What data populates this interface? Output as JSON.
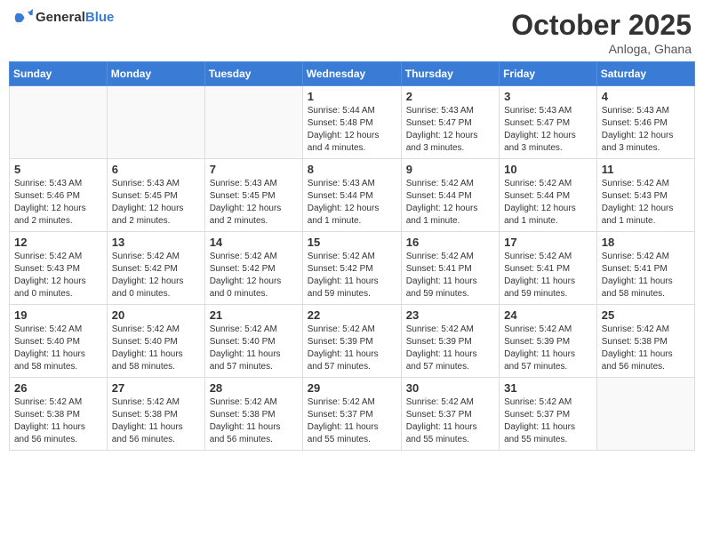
{
  "header": {
    "logo_general": "General",
    "logo_blue": "Blue",
    "month": "October 2025",
    "location": "Anloga, Ghana"
  },
  "weekdays": [
    "Sunday",
    "Monday",
    "Tuesday",
    "Wednesday",
    "Thursday",
    "Friday",
    "Saturday"
  ],
  "weeks": [
    [
      {
        "day": "",
        "info": ""
      },
      {
        "day": "",
        "info": ""
      },
      {
        "day": "",
        "info": ""
      },
      {
        "day": "1",
        "info": "Sunrise: 5:44 AM\nSunset: 5:48 PM\nDaylight: 12 hours\nand 4 minutes."
      },
      {
        "day": "2",
        "info": "Sunrise: 5:43 AM\nSunset: 5:47 PM\nDaylight: 12 hours\nand 3 minutes."
      },
      {
        "day": "3",
        "info": "Sunrise: 5:43 AM\nSunset: 5:47 PM\nDaylight: 12 hours\nand 3 minutes."
      },
      {
        "day": "4",
        "info": "Sunrise: 5:43 AM\nSunset: 5:46 PM\nDaylight: 12 hours\nand 3 minutes."
      }
    ],
    [
      {
        "day": "5",
        "info": "Sunrise: 5:43 AM\nSunset: 5:46 PM\nDaylight: 12 hours\nand 2 minutes."
      },
      {
        "day": "6",
        "info": "Sunrise: 5:43 AM\nSunset: 5:45 PM\nDaylight: 12 hours\nand 2 minutes."
      },
      {
        "day": "7",
        "info": "Sunrise: 5:43 AM\nSunset: 5:45 PM\nDaylight: 12 hours\nand 2 minutes."
      },
      {
        "day": "8",
        "info": "Sunrise: 5:43 AM\nSunset: 5:44 PM\nDaylight: 12 hours\nand 1 minute."
      },
      {
        "day": "9",
        "info": "Sunrise: 5:42 AM\nSunset: 5:44 PM\nDaylight: 12 hours\nand 1 minute."
      },
      {
        "day": "10",
        "info": "Sunrise: 5:42 AM\nSunset: 5:44 PM\nDaylight: 12 hours\nand 1 minute."
      },
      {
        "day": "11",
        "info": "Sunrise: 5:42 AM\nSunset: 5:43 PM\nDaylight: 12 hours\nand 1 minute."
      }
    ],
    [
      {
        "day": "12",
        "info": "Sunrise: 5:42 AM\nSunset: 5:43 PM\nDaylight: 12 hours\nand 0 minutes."
      },
      {
        "day": "13",
        "info": "Sunrise: 5:42 AM\nSunset: 5:42 PM\nDaylight: 12 hours\nand 0 minutes."
      },
      {
        "day": "14",
        "info": "Sunrise: 5:42 AM\nSunset: 5:42 PM\nDaylight: 12 hours\nand 0 minutes."
      },
      {
        "day": "15",
        "info": "Sunrise: 5:42 AM\nSunset: 5:42 PM\nDaylight: 11 hours\nand 59 minutes."
      },
      {
        "day": "16",
        "info": "Sunrise: 5:42 AM\nSunset: 5:41 PM\nDaylight: 11 hours\nand 59 minutes."
      },
      {
        "day": "17",
        "info": "Sunrise: 5:42 AM\nSunset: 5:41 PM\nDaylight: 11 hours\nand 59 minutes."
      },
      {
        "day": "18",
        "info": "Sunrise: 5:42 AM\nSunset: 5:41 PM\nDaylight: 11 hours\nand 58 minutes."
      }
    ],
    [
      {
        "day": "19",
        "info": "Sunrise: 5:42 AM\nSunset: 5:40 PM\nDaylight: 11 hours\nand 58 minutes."
      },
      {
        "day": "20",
        "info": "Sunrise: 5:42 AM\nSunset: 5:40 PM\nDaylight: 11 hours\nand 58 minutes."
      },
      {
        "day": "21",
        "info": "Sunrise: 5:42 AM\nSunset: 5:40 PM\nDaylight: 11 hours\nand 57 minutes."
      },
      {
        "day": "22",
        "info": "Sunrise: 5:42 AM\nSunset: 5:39 PM\nDaylight: 11 hours\nand 57 minutes."
      },
      {
        "day": "23",
        "info": "Sunrise: 5:42 AM\nSunset: 5:39 PM\nDaylight: 11 hours\nand 57 minutes."
      },
      {
        "day": "24",
        "info": "Sunrise: 5:42 AM\nSunset: 5:39 PM\nDaylight: 11 hours\nand 57 minutes."
      },
      {
        "day": "25",
        "info": "Sunrise: 5:42 AM\nSunset: 5:38 PM\nDaylight: 11 hours\nand 56 minutes."
      }
    ],
    [
      {
        "day": "26",
        "info": "Sunrise: 5:42 AM\nSunset: 5:38 PM\nDaylight: 11 hours\nand 56 minutes."
      },
      {
        "day": "27",
        "info": "Sunrise: 5:42 AM\nSunset: 5:38 PM\nDaylight: 11 hours\nand 56 minutes."
      },
      {
        "day": "28",
        "info": "Sunrise: 5:42 AM\nSunset: 5:38 PM\nDaylight: 11 hours\nand 56 minutes."
      },
      {
        "day": "29",
        "info": "Sunrise: 5:42 AM\nSunset: 5:37 PM\nDaylight: 11 hours\nand 55 minutes."
      },
      {
        "day": "30",
        "info": "Sunrise: 5:42 AM\nSunset: 5:37 PM\nDaylight: 11 hours\nand 55 minutes."
      },
      {
        "day": "31",
        "info": "Sunrise: 5:42 AM\nSunset: 5:37 PM\nDaylight: 11 hours\nand 55 minutes."
      },
      {
        "day": "",
        "info": ""
      }
    ]
  ]
}
